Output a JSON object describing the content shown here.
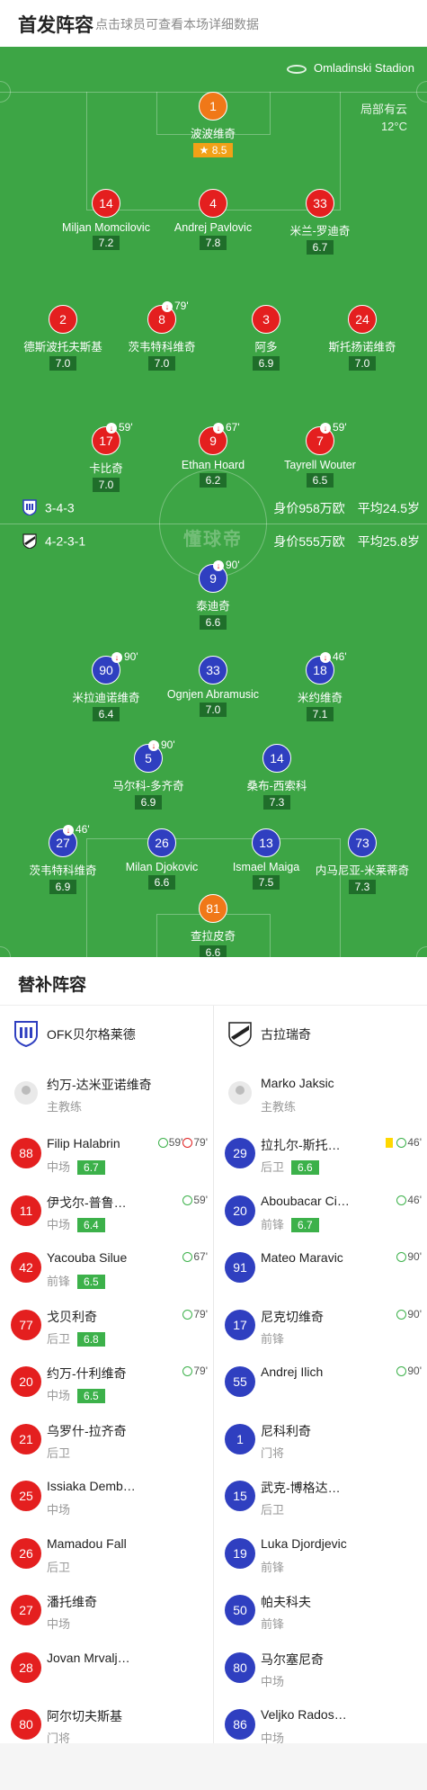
{
  "header": {
    "title": "首发阵容",
    "hint": "点击球员可查看本场详细数据"
  },
  "pitch": {
    "stadium": "Omladinski Stadion",
    "weather": "局部有云",
    "temperature": "12°C",
    "watermark": "懂球帝",
    "home": {
      "formation": "3-4-3",
      "value": "身价958万欧",
      "age": "平均24.5岁"
    },
    "away": {
      "formation": "4-2-3-1",
      "value": "身价555万欧",
      "age": "平均25.8岁"
    },
    "players": [
      {
        "num": "1",
        "name": "波波维奇",
        "rating": "8.5",
        "team": "gk",
        "captain": true,
        "best": true
      },
      {
        "num": "14",
        "name": "Miljan Momcilovic",
        "rating": "7.2",
        "team": "red"
      },
      {
        "num": "4",
        "name": "Andrej Pavlovic",
        "rating": "7.8",
        "team": "red"
      },
      {
        "num": "33",
        "name": "米兰-罗迪奇",
        "rating": "6.7",
        "team": "red",
        "yellow": true
      },
      {
        "num": "2",
        "name": "德斯波托夫斯基",
        "rating": "7.0",
        "team": "red"
      },
      {
        "num": "8",
        "name": "茨韦特科维奇",
        "rating": "7.0",
        "team": "red",
        "sub_off": "79'"
      },
      {
        "num": "3",
        "name": "阿多",
        "rating": "6.9",
        "team": "red"
      },
      {
        "num": "24",
        "name": "斯托扬诺维奇",
        "rating": "7.0",
        "team": "red"
      },
      {
        "num": "17",
        "name": "卡比奇",
        "rating": "7.0",
        "team": "red",
        "sub_off": "59'"
      },
      {
        "num": "9",
        "name": "Ethan Hoard",
        "rating": "6.2",
        "team": "red",
        "sub_off": "67'"
      },
      {
        "num": "7",
        "name": "Tayrell Wouter",
        "rating": "6.5",
        "team": "red",
        "sub_off": "59'"
      },
      {
        "num": "9",
        "name": "泰迪奇",
        "rating": "6.6",
        "team": "blue",
        "sub_off": "90'"
      },
      {
        "num": "90",
        "name": "米拉迪诺维奇",
        "rating": "6.4",
        "team": "blue",
        "yellow": true,
        "sub_off": "90'"
      },
      {
        "num": "33",
        "name": "Ognjen Abramusic",
        "rating": "7.0",
        "team": "blue",
        "yellow": true
      },
      {
        "num": "18",
        "name": "米约维奇",
        "rating": "7.1",
        "team": "blue",
        "sub_off": "46'"
      },
      {
        "num": "5",
        "name": "马尔科-多齐奇",
        "rating": "6.9",
        "team": "blue",
        "captain": true,
        "sub_off": "90'"
      },
      {
        "num": "14",
        "name": "桑布-西索科",
        "rating": "7.3",
        "team": "blue"
      },
      {
        "num": "27",
        "name": "茨韦特科维奇",
        "rating": "6.9",
        "team": "blue",
        "sub_off": "46'"
      },
      {
        "num": "26",
        "name": "Milan Djokovic",
        "rating": "6.6",
        "team": "blue"
      },
      {
        "num": "13",
        "name": "Ismael Maiga",
        "rating": "7.5",
        "team": "blue"
      },
      {
        "num": "73",
        "name": "内马尼亚-米莱蒂奇",
        "rating": "7.3",
        "team": "blue"
      },
      {
        "num": "81",
        "name": "查拉皮奇",
        "rating": "6.6",
        "team": "gk"
      }
    ]
  },
  "subs": {
    "title": "替补阵容",
    "home": {
      "team": "OFK贝尔格莱德",
      "coach": {
        "name": "约万-达米亚诺维奇",
        "role": "主教练"
      },
      "players": [
        {
          "num": "88",
          "name": "Filip Halabrin",
          "pos": "中场",
          "rating": "6.7",
          "in": "59'",
          "out": "79'"
        },
        {
          "num": "11",
          "name": "伊戈尔-普鲁…",
          "pos": "中场",
          "rating": "6.4",
          "in": "59'"
        },
        {
          "num": "42",
          "name": "Yacouba Silue",
          "pos": "前锋",
          "rating": "6.5",
          "in": "67'"
        },
        {
          "num": "77",
          "name": "戈贝利奇",
          "pos": "后卫",
          "rating": "6.8",
          "in": "79'"
        },
        {
          "num": "20",
          "name": "约万-什利维奇",
          "pos": "中场",
          "rating": "6.5",
          "in": "79'"
        },
        {
          "num": "21",
          "name": "乌罗什-拉齐奇",
          "pos": "后卫"
        },
        {
          "num": "25",
          "name": "Issiaka Demb…",
          "pos": "中场"
        },
        {
          "num": "26",
          "name": "Mamadou Fall",
          "pos": "后卫"
        },
        {
          "num": "27",
          "name": "潘托维奇",
          "pos": "中场"
        },
        {
          "num": "28",
          "name": "Jovan Mrvalj…",
          "pos": ""
        },
        {
          "num": "80",
          "name": "阿尔切夫斯基",
          "pos": "门将"
        }
      ]
    },
    "away": {
      "team": "古拉瑞奇",
      "coach": {
        "name": "Marko Jaksic",
        "role": "主教练"
      },
      "players": [
        {
          "num": "29",
          "name": "拉扎尔-斯托…",
          "pos": "后卫",
          "rating": "6.6",
          "in": "46'",
          "yellow": true
        },
        {
          "num": "20",
          "name": "Aboubacar Ci…",
          "pos": "前锋",
          "rating": "6.7",
          "in": "46'"
        },
        {
          "num": "91",
          "name": "Mateo Maravic",
          "pos": "",
          "in": "90'"
        },
        {
          "num": "17",
          "name": "尼克切维奇",
          "pos": "前锋",
          "in": "90'"
        },
        {
          "num": "55",
          "name": "Andrej Ilich",
          "pos": "",
          "in": "90'"
        },
        {
          "num": "1",
          "name": "尼科利奇",
          "pos": "门将"
        },
        {
          "num": "15",
          "name": "武克-博格达…",
          "pos": "后卫"
        },
        {
          "num": "19",
          "name": "Luka Djordjevic",
          "pos": "前锋"
        },
        {
          "num": "50",
          "name": "帕夫科夫",
          "pos": "前锋"
        },
        {
          "num": "80",
          "name": "马尔塞尼奇",
          "pos": "中场"
        },
        {
          "num": "86",
          "name": "Veljko Rados…",
          "pos": "中场"
        }
      ]
    }
  }
}
